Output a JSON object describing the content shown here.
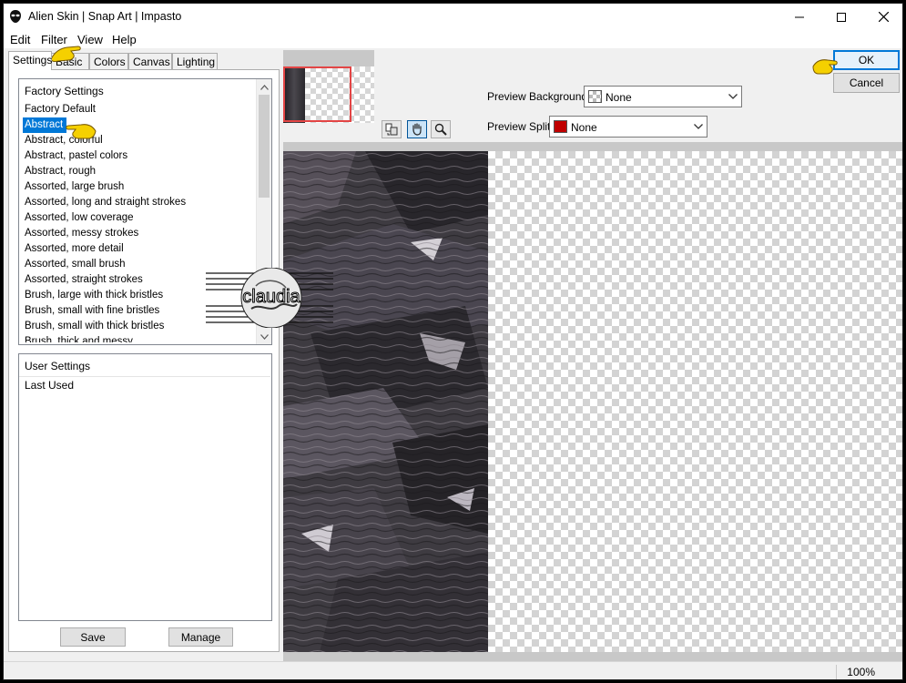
{
  "window": {
    "title": "Alien Skin | Snap Art | Impasto",
    "minimize_icon": "minimize-icon",
    "maximize_icon": "maximize-icon",
    "close_icon": "close-icon"
  },
  "menu": {
    "items": [
      "Edit",
      "Filter",
      "View",
      "Help"
    ]
  },
  "tabs": {
    "items": [
      "Settings",
      "Basic",
      "Colors",
      "Canvas",
      "Lighting"
    ],
    "active": "Settings"
  },
  "factory_settings": {
    "header": "Factory Settings",
    "items": [
      "Factory Default",
      "Abstract",
      "Abstract, colorful",
      "Abstract, pastel colors",
      "Abstract, rough",
      "Assorted, large brush",
      "Assorted, long and straight strokes",
      "Assorted, low coverage",
      "Assorted, messy strokes",
      "Assorted, more detail",
      "Assorted, small brush",
      "Assorted, straight strokes",
      "Brush, large with thick bristles",
      "Brush, small with fine bristles",
      "Brush, small with thick bristles",
      "Brush, thick and messy"
    ],
    "selected": "Abstract"
  },
  "user_settings": {
    "header": "User Settings",
    "items": [
      "Last Used"
    ]
  },
  "buttons": {
    "save": "Save",
    "manage": "Manage",
    "ok": "OK",
    "cancel": "Cancel"
  },
  "preview_background": {
    "label": "Preview Background:",
    "value": "None",
    "swatch_color": "#ffffff"
  },
  "preview_split": {
    "label": "Preview Split:",
    "value": "None",
    "swatch_color": "#c00000"
  },
  "tools": [
    "compare-icon",
    "hand-icon",
    "zoom-icon"
  ],
  "status": {
    "zoom": "100%"
  },
  "watermark": {
    "text": "claudia"
  },
  "colors": {
    "selection": "#0078d7",
    "thumb_frame": "#e34545",
    "pointer": "#f5d000"
  }
}
